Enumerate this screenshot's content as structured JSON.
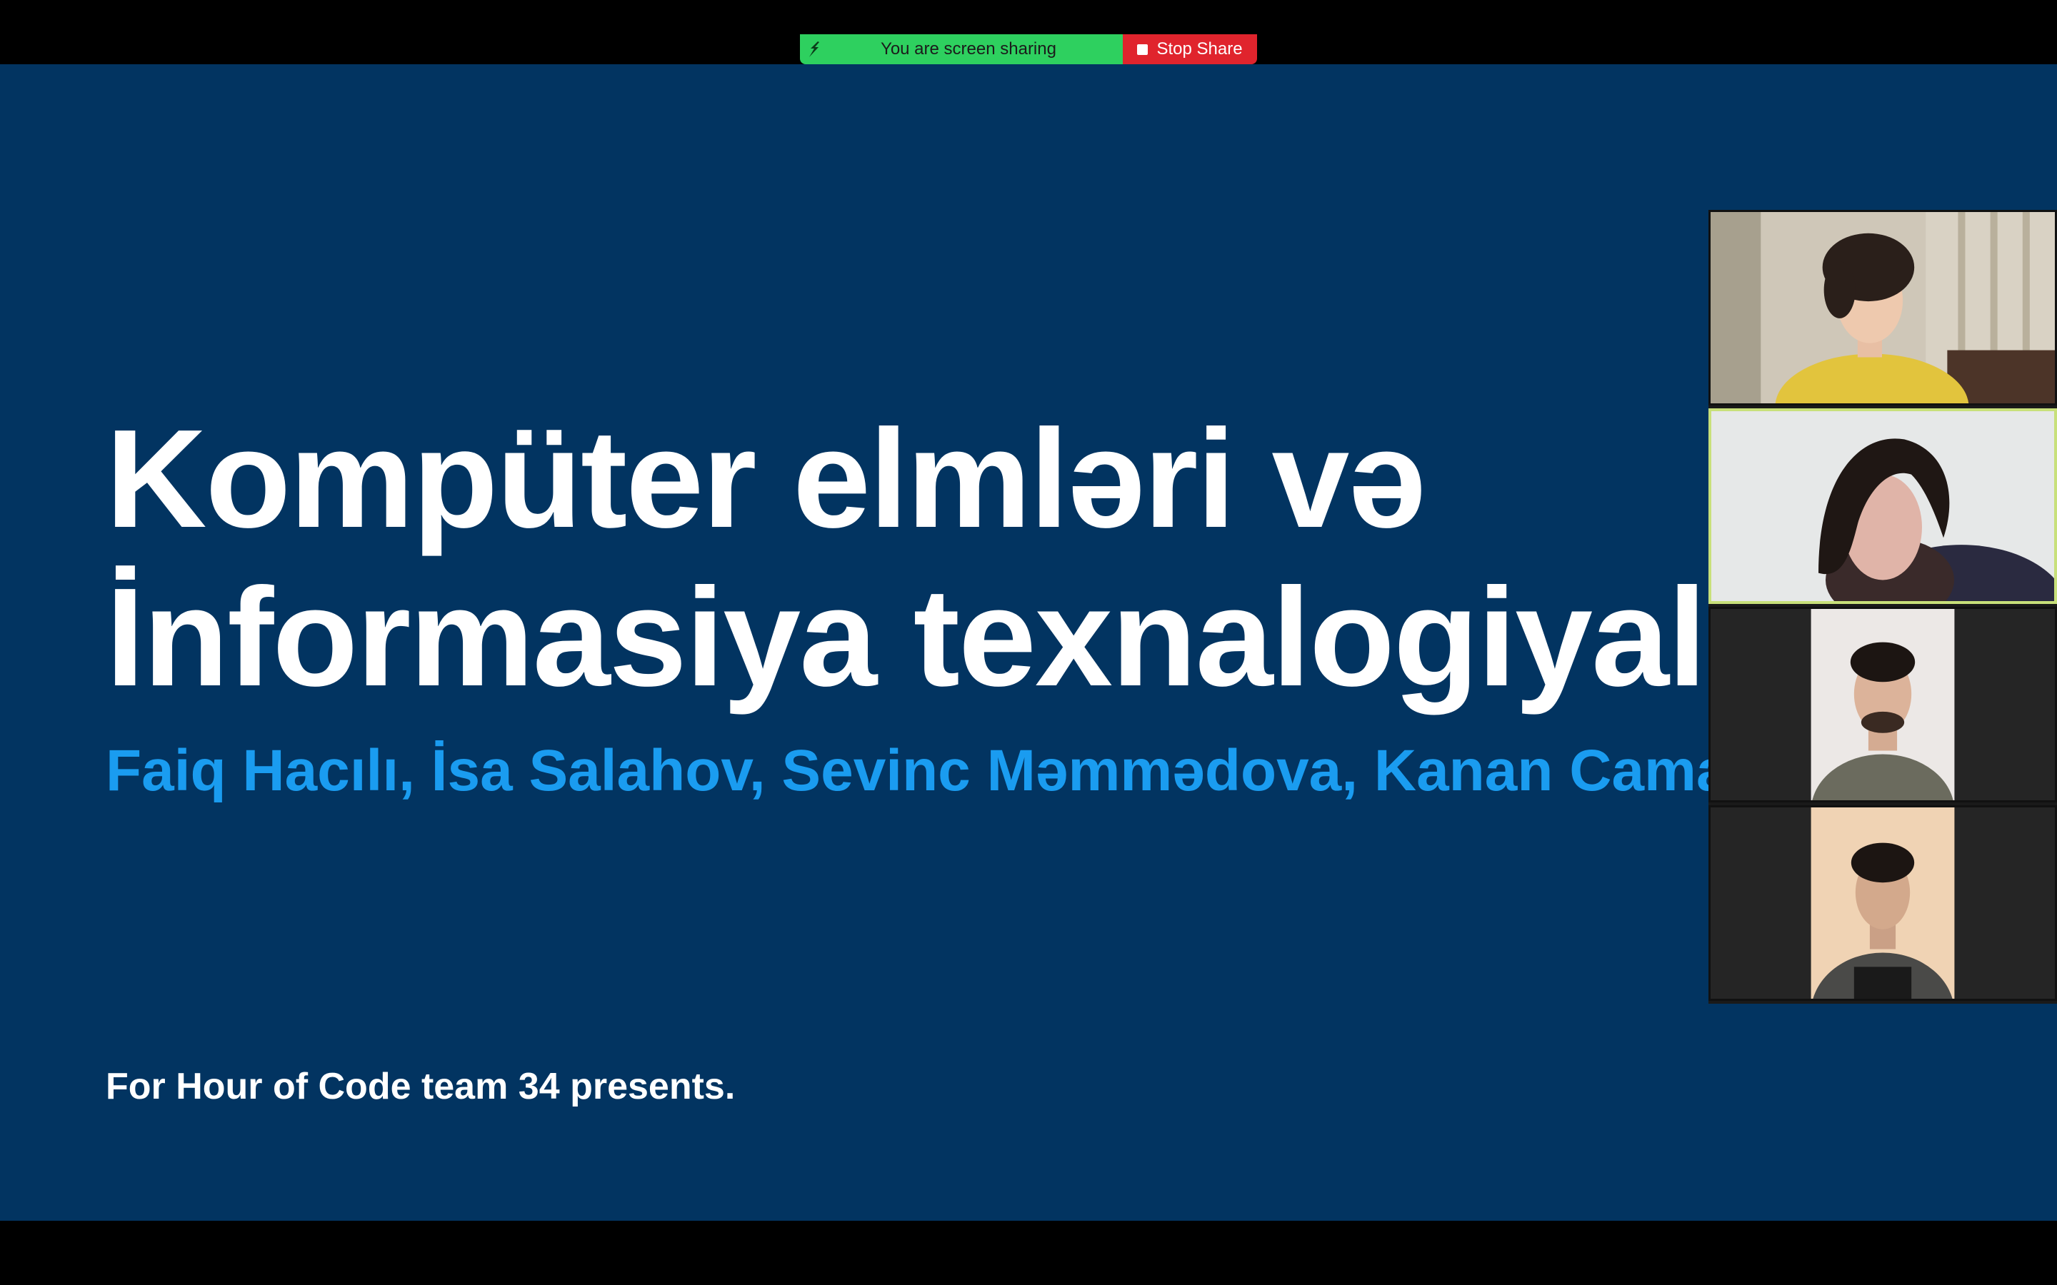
{
  "share_bar": {
    "status_text": "You are screen sharing",
    "stop_label": "Stop Share",
    "status_color": "#2ed05f",
    "stop_color": "#e0242d"
  },
  "slide": {
    "background_color": "#023461",
    "title_lines": [
      "Kompüter elmləri və",
      "İnformasiya texnalogiyaları"
    ],
    "authors": "Faiq Hacılı, İsa Salahov, Sevinc Məmmədova, Kanan Camalov",
    "footer": "For Hour of Code team 34 presents.",
    "accent_color": "#1a9cf0"
  },
  "gallery": {
    "active_tile_color": "#c8e07a",
    "participants": [
      {
        "icon": "participant-video",
        "active": false
      },
      {
        "icon": "participant-video",
        "active": true
      },
      {
        "icon": "participant-video",
        "active": false
      },
      {
        "icon": "participant-video",
        "active": false
      }
    ]
  }
}
